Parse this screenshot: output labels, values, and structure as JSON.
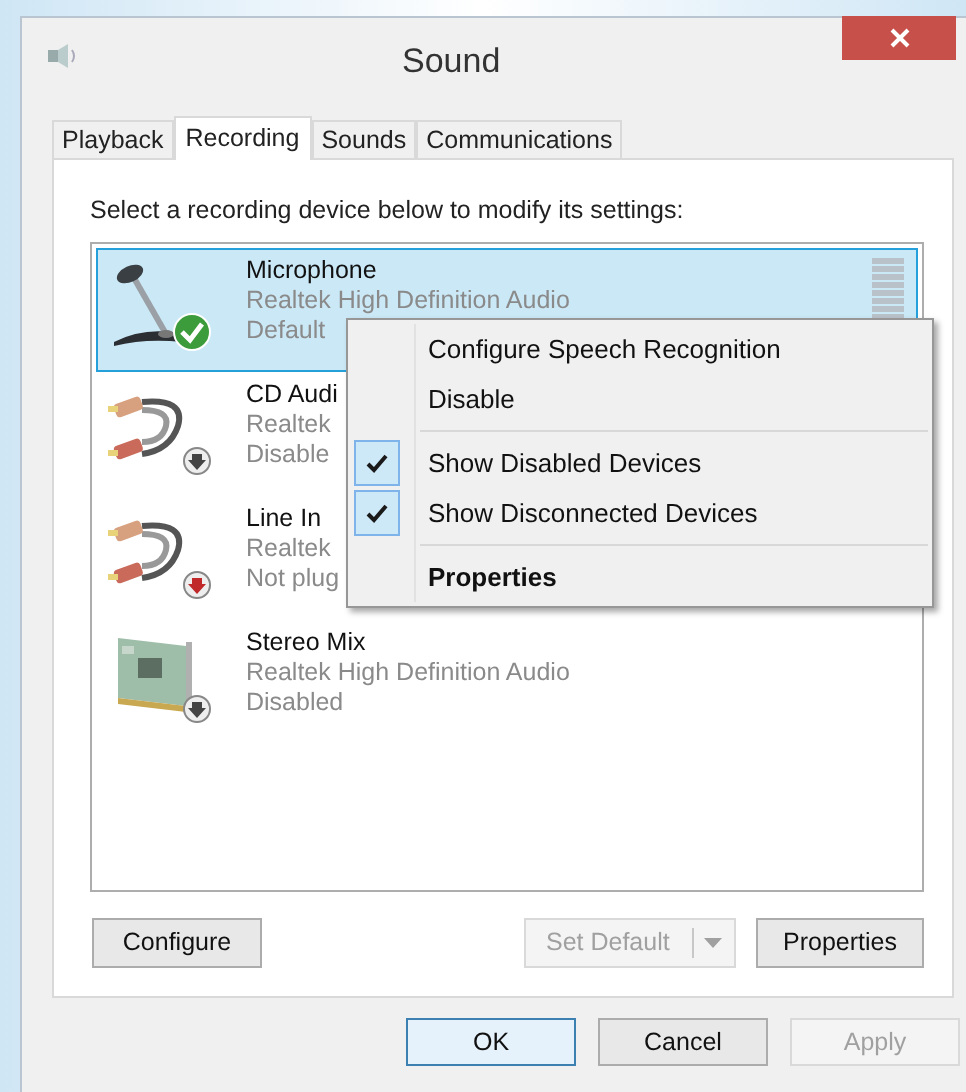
{
  "window": {
    "title": "Sound"
  },
  "tabs": [
    {
      "label": "Playback",
      "selected": false
    },
    {
      "label": "Recording",
      "selected": true
    },
    {
      "label": "Sounds",
      "selected": false
    },
    {
      "label": "Communications",
      "selected": false
    }
  ],
  "instruction": "Select a recording device below to modify its settings:",
  "devices": [
    {
      "kind": "microphone",
      "name": "Microphone",
      "lines": [
        "Realtek High Definition Audio",
        "Default"
      ],
      "default_device": true,
      "unplugged": false,
      "selected": true
    },
    {
      "kind": "cable",
      "name": "CD Audi",
      "lines": [
        "Realtek",
        "Disable"
      ],
      "default_device": false,
      "unplugged": false,
      "selected": false
    },
    {
      "kind": "cable",
      "name": "Line In",
      "lines": [
        "Realtek",
        "Not plug"
      ],
      "default_device": false,
      "unplugged": true,
      "selected": false
    },
    {
      "kind": "card",
      "name": "Stereo Mix",
      "lines": [
        "Realtek High Definition Audio",
        "Disabled"
      ],
      "default_device": false,
      "unplugged": false,
      "selected": false
    }
  ],
  "context_menu": [
    [
      {
        "label": "Configure Speech Recognition",
        "checked": false,
        "bold": false
      },
      {
        "label": "Disable",
        "checked": false,
        "bold": false
      }
    ],
    [
      {
        "label": "Show Disabled Devices",
        "checked": true,
        "bold": false
      },
      {
        "label": "Show Disconnected Devices",
        "checked": true,
        "bold": false
      }
    ],
    [
      {
        "label": "Properties",
        "checked": false,
        "bold": true
      }
    ]
  ],
  "panel_buttons": [
    {
      "label": "Configure",
      "disabled": false,
      "split": false
    },
    {
      "label": "Set Default",
      "disabled": true,
      "split": true
    },
    {
      "label": "Properties",
      "disabled": false,
      "split": false
    }
  ],
  "dialog_buttons": [
    {
      "label": "OK",
      "disabled": false,
      "default": true
    },
    {
      "label": "Cancel",
      "disabled": false,
      "default": false
    },
    {
      "label": "Apply",
      "disabled": true,
      "default": false
    }
  ]
}
